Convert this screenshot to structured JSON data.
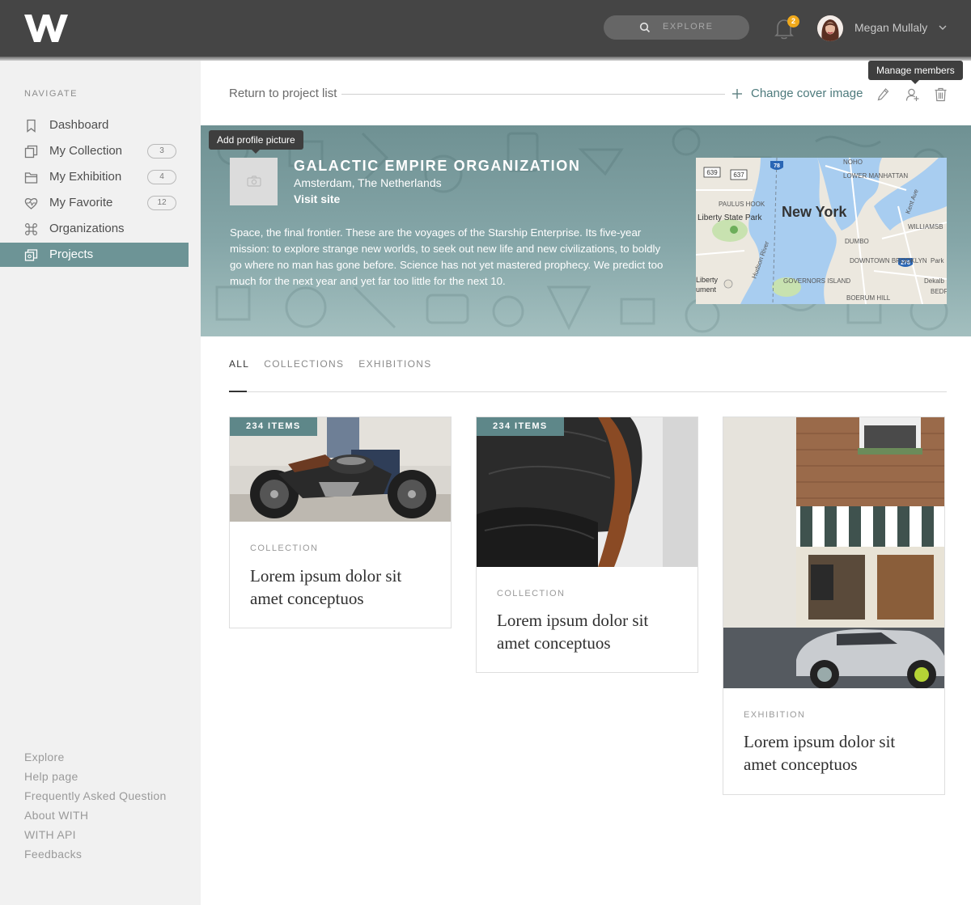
{
  "header": {
    "logo": "with-logo",
    "search_placeholder": "EXPLORE",
    "notifications_count": "2",
    "user_name": "Megan Mullaly"
  },
  "sidebar": {
    "heading": "NAVIGATE",
    "items": [
      {
        "label": "Dashboard",
        "icon": "bookmark-icon",
        "count": ""
      },
      {
        "label": "My Collection",
        "icon": "collection-icon",
        "count": "3"
      },
      {
        "label": "My Exhibition",
        "icon": "folder-icon",
        "count": "4"
      },
      {
        "label": "My Favorite",
        "icon": "heart-icon",
        "count": "12"
      },
      {
        "label": "Organizations",
        "icon": "command-icon",
        "count": ""
      },
      {
        "label": "Projects",
        "icon": "projects-icon",
        "count": "",
        "active": true
      }
    ],
    "footer_links": [
      "Explore",
      "Help page",
      "Frequently Asked Question",
      "About WITH",
      "WITH API",
      "Feedbacks"
    ]
  },
  "actions": {
    "return_label": "Return to project list",
    "change_cover_label": "Change cover image",
    "manage_members_tooltip": "Manage members",
    "add_profile_tooltip": "Add profile picture"
  },
  "organization": {
    "title": "GALACTIC EMPIRE ORGANIZATION",
    "location": "Amsterdam, The Netherlands",
    "site_label": "Visit site",
    "description": "Space, the final frontier. These are the voyages of the Starship Enterprise. Its five-year mission: to explore strange new worlds, to seek out new life and new civilizations, to boldly go where no man has gone before. Science has not yet mastered prophecy. We predict too much for the next year and yet far too little for the next 10."
  },
  "map": {
    "city": "New York",
    "labels": [
      "NOHO",
      "LOWER MANHATTAN",
      "PAULUS HOOK",
      "Liberty State Park",
      "Hudson River",
      "DUMBO",
      "DOWNTOWN BROOKLYN",
      "GOVERNORS ISLAND",
      "BOERUM HILL",
      "WILLIAMSB",
      "Kent Ave",
      "Park",
      "Dekalb",
      "BEDF",
      "Liberty",
      "ument"
    ],
    "shields": [
      "639",
      "637",
      "78",
      "278"
    ]
  },
  "tabs": [
    {
      "label": "ALL",
      "active": true
    },
    {
      "label": "COLLECTIONS",
      "active": false
    },
    {
      "label": "EXHIBITIONS",
      "active": false
    }
  ],
  "cards": [
    {
      "badge": "234 ITEMS",
      "type": "COLLECTION",
      "title": "Lorem ipsum dolor sit amet conceptuos",
      "image": "motorcycle"
    },
    {
      "badge": "234 ITEMS",
      "type": "COLLECTION",
      "title": "Lorem ipsum dolor sit amet conceptuos",
      "image": "lounge-chair"
    },
    {
      "badge": "",
      "type": "EXHIBITION",
      "title": "Lorem ipsum dolor sit amet conceptuos",
      "image": "storefront-car"
    }
  ],
  "colors": {
    "topbar": "#454545",
    "accent": "#6d9496",
    "badge_bg": "#5e8789",
    "notification": "#f0a91b",
    "link": "#4d7a7c"
  }
}
